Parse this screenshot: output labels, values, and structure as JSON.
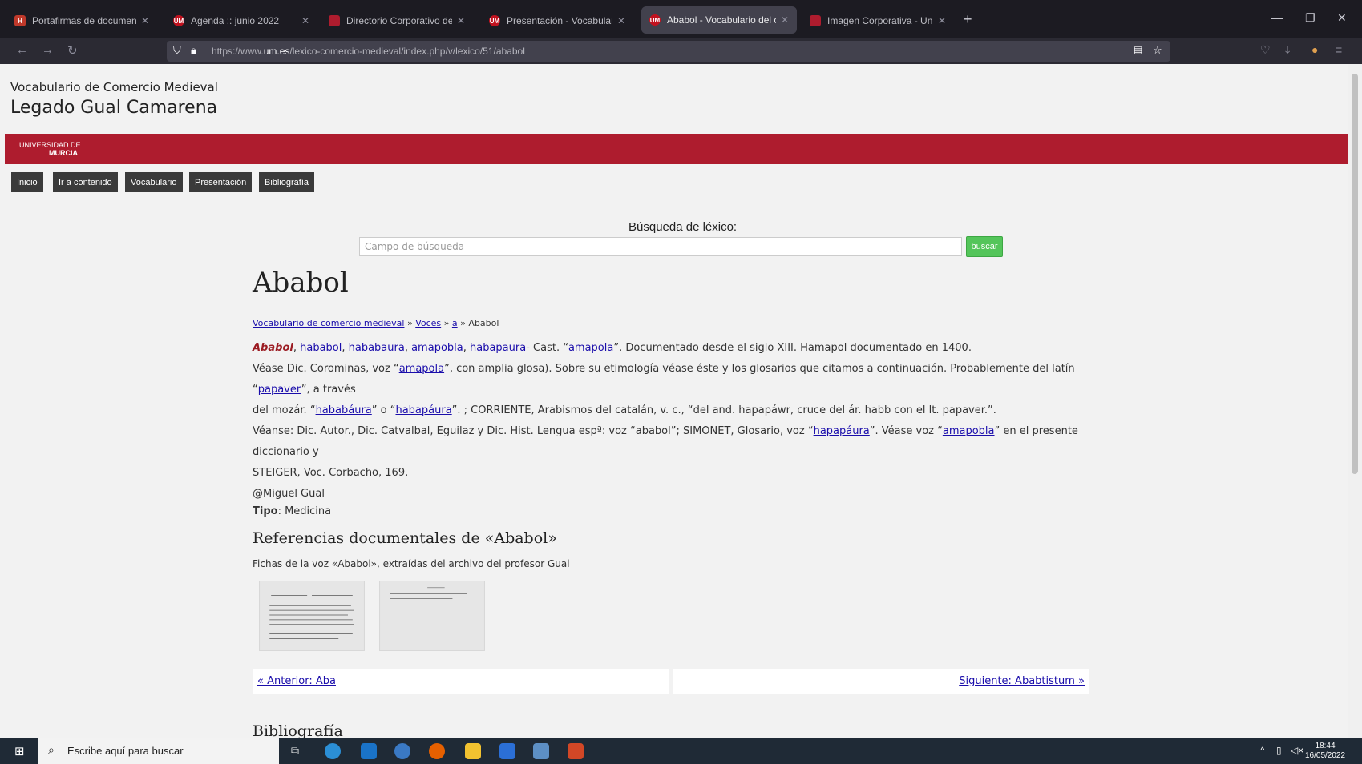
{
  "browser": {
    "tabs": [
      {
        "title": "Portafirmas de documentos ele",
        "active": false
      },
      {
        "title": "Agenda :: junio 2022",
        "active": false
      },
      {
        "title": "Directorio Corporativo de la Ui",
        "active": false
      },
      {
        "title": "Presentación - Vocabulario del",
        "active": false
      },
      {
        "title": "Ababol - Vocabulario del come",
        "active": true
      },
      {
        "title": "Imagen Corporativa - Universi",
        "active": false
      }
    ],
    "url_prefix": "https://www.",
    "url_domain": "um.es",
    "url_path": "/lexico-comercio-medieval/index.php/v/lexico/51/ababol"
  },
  "site": {
    "subtitle": "Vocabulario de Comercio Medieval",
    "title": "Legado Gual Camarena",
    "logo_line1": "UNIVERSIDAD DE",
    "logo_line2": "MURCIA",
    "menu": [
      "Inicio",
      "Ir a contenido",
      "Vocabulario",
      "Presentación",
      "Bibliografía"
    ]
  },
  "search": {
    "label": "Búsqueda de léxico:",
    "placeholder": "Campo de búsqueda",
    "button": "buscar"
  },
  "entry": {
    "title": "Ababol",
    "breadcrumb": {
      "root": "Vocabulario de comercio medieval",
      "sep": " » ",
      "voces": "Voces",
      "letter": "a",
      "current": "Ababol"
    },
    "headword": "Ababol",
    "variants": [
      "hababol",
      "hababaura",
      "amapobla",
      "habapaura"
    ],
    "line1_rest_a": "- Cast. “",
    "line1_link": "amapola",
    "line1_rest_b": "”. Documentado desde el siglo XIII. Hamapol documentado en 1400.",
    "line2_a": "Véase Dic. Corominas, voz “",
    "line2_link1": "amapola",
    "line2_b": "”, con amplia glosa). Sobre su etimología véase éste y los glosarios que citamos a continuación. Probablemente del latín “",
    "line2_link2": "papaver",
    "line2_c": "”, a través",
    "line3_a": "del mozár. “",
    "line3_link1": "hababáura",
    "line3_b": "” o “",
    "line3_link2": "habapáura",
    "line3_c": "”. ; CORRIENTE, Arabismos del catalán, v. c., “del and. hapapáwr, cruce del ár. habb con el lt. papaver.”.",
    "line4_a": "Véanse: Dic. Autor., Dic. Catvalbal, Eguilaz y Dic. Hist. Lengua espª: voz “ababol”; SIMONET, Glosario, voz “",
    "line4_link1": "hapapáura",
    "line4_b": "”. Véase voz “",
    "line4_link2": "amapobla",
    "line4_c": "” en el presente diccionario y",
    "line5": "STEIGER, Voc. Corbacho, 169.",
    "author": "@Miguel Gual",
    "tipo_label": "Tipo",
    "tipo_value": "Medicina",
    "refs_title": "Referencias documentales de «Ababol»",
    "refs_desc": "Fichas de la voz «Ababol», extraídas del archivo del profesor Gual",
    "prev": "« Anterior: Aba",
    "next": "Siguiente: Ababtistum »",
    "bib_title": "Bibliografía"
  },
  "taskbar": {
    "search_placeholder": "Escribe aquí para buscar",
    "time": "18:44",
    "date": "16/05/2022"
  }
}
